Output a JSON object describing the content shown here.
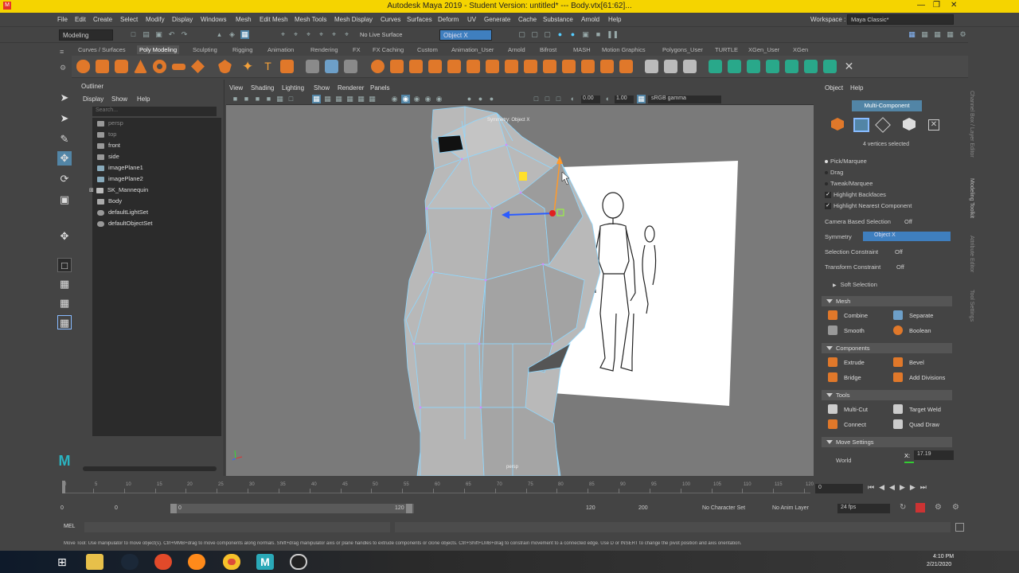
{
  "window": {
    "title": "Autodesk Maya 2019 - Student Version: untitled*  ---  Body.vtx[61:62]..."
  },
  "menubar": {
    "items": [
      "File",
      "Edit",
      "Create",
      "Select",
      "Modify",
      "Display",
      "Windows",
      "Mesh",
      "Edit Mesh",
      "Mesh Tools",
      "Mesh Display",
      "Curves",
      "Surfaces",
      "Deform",
      "UV",
      "Generate",
      "Cache",
      "Substance",
      "Arnold",
      "Help"
    ],
    "workspace_label": "Workspace :",
    "workspace_value": "Maya Classic*"
  },
  "statusline": {
    "mode": "Modeling",
    "live_surface": "No Live Surface",
    "symmetry_field": "Object X"
  },
  "shelf": {
    "tabs": [
      "Curves / Surfaces",
      "Poly Modeling",
      "Sculpting",
      "Rigging",
      "Animation",
      "Rendering",
      "FX",
      "FX Caching",
      "Custom",
      "Animation_User",
      "Arnold",
      "Bifrost",
      "MASH",
      "Motion Graphics",
      "Polygons_User",
      "TURTLE",
      "XGen_User",
      "XGen"
    ],
    "active_tab": "Poly Modeling"
  },
  "right_strip": {
    "tabs": [
      "Channel Box / Layer Editor",
      "Modeling Toolkit",
      "Attribute Editor",
      "Tool Settings"
    ]
  },
  "outliner": {
    "title": "Outliner",
    "menu": [
      "Display",
      "Show",
      "Help"
    ],
    "search_placeholder": "Search...",
    "items": [
      {
        "label": "persp",
        "dim": true
      },
      {
        "label": "top",
        "dim": true
      },
      {
        "label": "front",
        "dim": false
      },
      {
        "label": "side",
        "dim": false
      },
      {
        "label": "imagePlane1",
        "dim": false
      },
      {
        "label": "imagePlane2",
        "dim": false
      },
      {
        "label": "SK_Mannequin",
        "dim": false
      },
      {
        "label": "Body",
        "dim": false
      },
      {
        "label": "defaultLightSet",
        "dim": false
      },
      {
        "label": "defaultObjectSet",
        "dim": false
      }
    ]
  },
  "viewport": {
    "menu": [
      "View",
      "Shading",
      "Lighting",
      "Show",
      "Renderer",
      "Panels"
    ],
    "value1": "0.00",
    "value2": "1.00",
    "colorspace": "sRGB gamma",
    "symmetry_label": "Symmetry: Object X",
    "camera_label": "persp"
  },
  "modeling_toolkit": {
    "menu": [
      "Object",
      "Help"
    ],
    "mode": "Multi-Component",
    "selection_info": "4 vertices selected",
    "options": [
      "Pick/Marquee",
      "Drag",
      "Tweak/Marquee"
    ],
    "checkboxes": [
      "Highlight Backfaces",
      "Highlight Nearest Component"
    ],
    "camera_based_label": "Camera Based Selection",
    "camera_based_value": "Off",
    "symmetry_label": "Symmetry",
    "symmetry_value": "Object X",
    "sel_constraint_label": "Selection Constraint",
    "sel_constraint_value": "Off",
    "transform_constraint_label": "Transform Constraint",
    "transform_constraint_value": "Off",
    "soft_selection": "Soft Selection",
    "mesh": {
      "title": "Mesh",
      "buttons": [
        "Combine",
        "Separate",
        "Smooth",
        "Boolean"
      ]
    },
    "components": {
      "title": "Components",
      "buttons": [
        "Extrude",
        "Bevel",
        "Bridge",
        "Add Divisions"
      ]
    },
    "tools": {
      "title": "Tools",
      "buttons": [
        "Multi-Cut",
        "Target Weld",
        "Connect",
        "Quad Draw"
      ]
    },
    "move_settings": {
      "title": "Move Settings",
      "space": "World",
      "axis": "X:",
      "value": "17.19"
    }
  },
  "timeline": {
    "ticks": [
      "0",
      "5",
      "10",
      "15",
      "20",
      "25",
      "30",
      "35",
      "40",
      "45",
      "50",
      "55",
      "60",
      "65",
      "70",
      "75",
      "80",
      "85",
      "90",
      "95",
      "100",
      "105",
      "110",
      "115",
      "120"
    ],
    "current_frame": "0"
  },
  "range": {
    "start": "0",
    "start2": "0",
    "slider_start": "0",
    "slider_end": "120",
    "end": "120",
    "end2": "200",
    "character_set": "No Character Set",
    "anim_layer": "No Anim Layer",
    "fps": "24 fps"
  },
  "cmdline": {
    "label": "MEL"
  },
  "helpline": {
    "text": "Move Tool: Use manipulator to move object(s). Ctrl+MMB+drag to move components along normals. Shift+drag manipulator axis or plane handles to extrude components or clone objects. Ctrl+Shift+LMB+drag to constrain movement to a connected edge. Use D or INSERT to change the pivot position and axis orientation."
  },
  "taskbar": {
    "time": "4:10 PM",
    "date": "2/21/2020"
  },
  "colors": {
    "title_bar": "#f5d400",
    "panel": "#444444",
    "viewport": "#7a7a7a",
    "mesh": "#b9b9b9",
    "wire": "#8fd8ff",
    "symmetry_field": "#3f7fbf"
  }
}
